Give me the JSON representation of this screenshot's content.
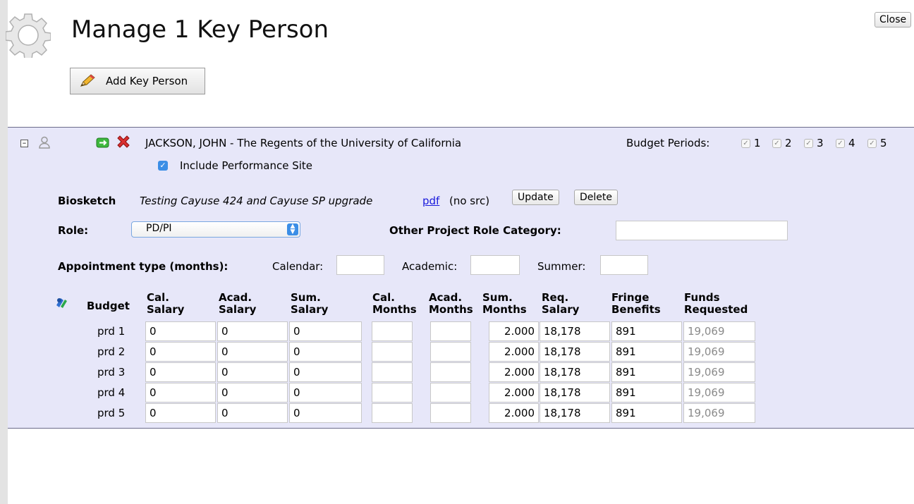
{
  "page": {
    "title": "Manage 1 Key Person",
    "close_label": "Close"
  },
  "toolbar": {
    "add_label": "Add Key Person"
  },
  "person": {
    "name": "JACKSON, JOHN - The Regents of the University of California",
    "include_site_label": "Include Performance Site",
    "budget_periods_label": "Budget Periods:",
    "periods": [
      "1",
      "2",
      "3",
      "4",
      "5"
    ]
  },
  "biosketch": {
    "label": "Biosketch",
    "title": "Testing Cayuse 424 and Cayuse SP upgrade",
    "link": "pdf",
    "note": "(no src)",
    "update_label": "Update",
    "delete_label": "Delete"
  },
  "role": {
    "label": "Role:",
    "value": "PD/PI",
    "other_label": "Other Project Role Category:",
    "other_value": ""
  },
  "appointment": {
    "label": "Appointment type (months):",
    "calendar_label": "Calendar:",
    "academic_label": "Academic:",
    "summer_label": "Summer:",
    "calendar": "",
    "academic": "",
    "summer": ""
  },
  "budget_table": {
    "row_header": "Budget",
    "columns": [
      [
        "Cal.",
        "Salary"
      ],
      [
        "Acad.",
        "Salary"
      ],
      [
        "Sum.",
        "Salary"
      ],
      [
        "Cal.",
        "Months"
      ],
      [
        "Acad.",
        "Months"
      ],
      [
        "Sum.",
        "Months"
      ],
      [
        "Req.",
        "Salary"
      ],
      [
        "Fringe",
        "Benefits"
      ],
      [
        "Funds",
        "Requested"
      ]
    ],
    "rows": [
      {
        "label": "prd 1",
        "cells": [
          "0",
          "0",
          "0",
          "",
          "",
          "2.000",
          "18,178",
          "891",
          "19,069"
        ]
      },
      {
        "label": "prd 2",
        "cells": [
          "0",
          "0",
          "0",
          "",
          "",
          "2.000",
          "18,178",
          "891",
          "19,069"
        ]
      },
      {
        "label": "prd 3",
        "cells": [
          "0",
          "0",
          "0",
          "",
          "",
          "2.000",
          "18,178",
          "891",
          "19,069"
        ]
      },
      {
        "label": "prd 4",
        "cells": [
          "0",
          "0",
          "0",
          "",
          "",
          "2.000",
          "18,178",
          "891",
          "19,069"
        ]
      },
      {
        "label": "prd 5",
        "cells": [
          "0",
          "0",
          "0",
          "",
          "",
          "2.000",
          "18,178",
          "891",
          "19,069"
        ]
      }
    ]
  }
}
